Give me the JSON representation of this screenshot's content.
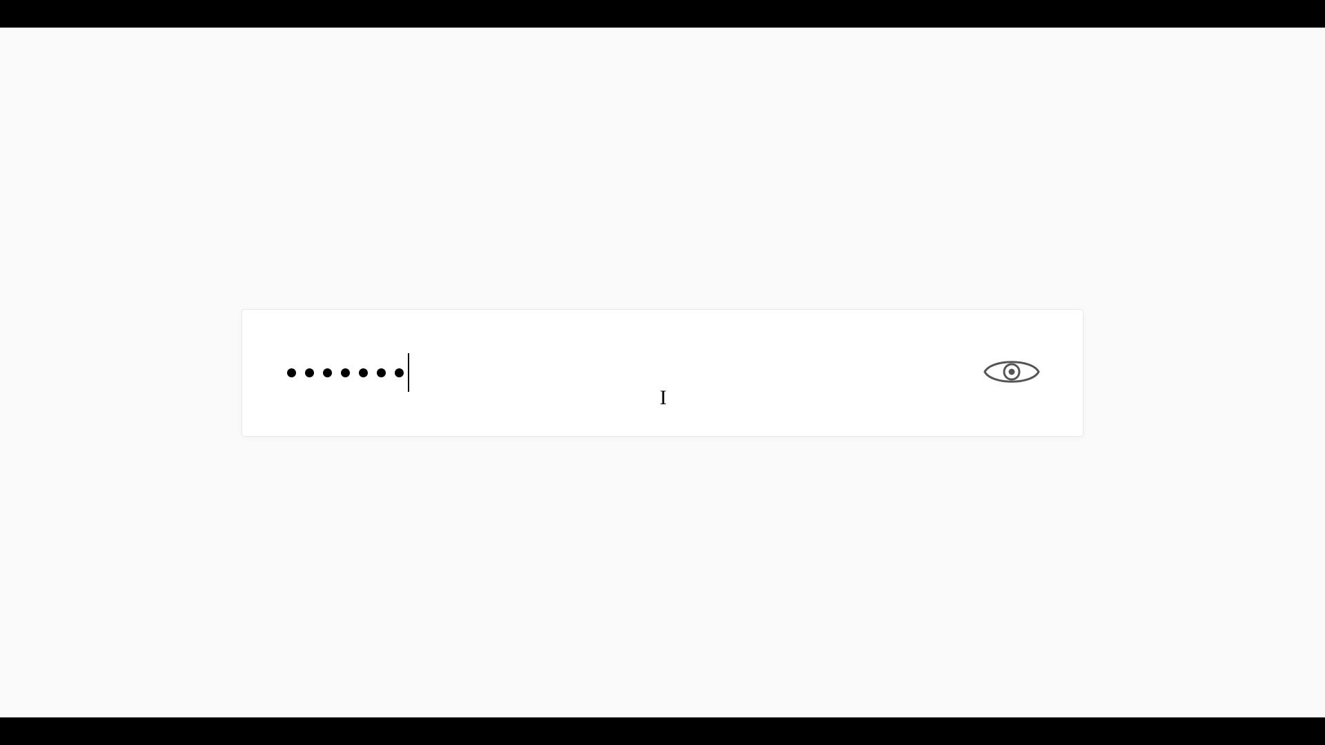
{
  "password": {
    "masked_char_count": 7,
    "cursor_visible": true
  },
  "toggle": {
    "aria_label": "Show password"
  }
}
